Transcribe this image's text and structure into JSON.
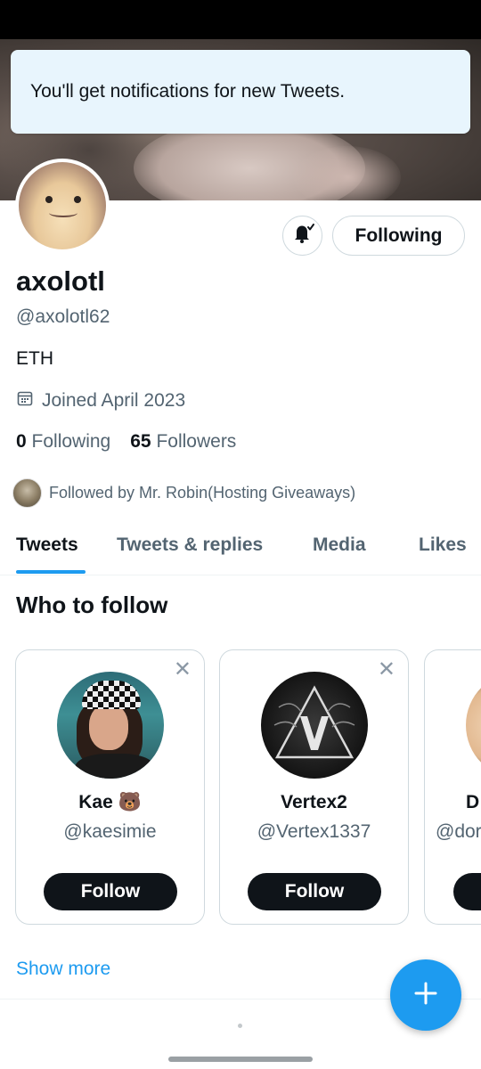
{
  "toast": {
    "message": "You'll get notifications for new Tweets."
  },
  "profile": {
    "display_name": "axolotl",
    "handle": "@axolotl62",
    "bio": "ETH",
    "joined": "Joined April 2023",
    "following_count": "0",
    "following_label": "Following",
    "followers_count": "65",
    "followers_label": "Followers",
    "followed_by": "Followed by Mr. Robin(Hosting Giveaways)",
    "follow_state_label": "Following",
    "bell_icon": "bell-subscribed-icon"
  },
  "tabs": [
    {
      "label": "Tweets",
      "active": true
    },
    {
      "label": "Tweets & replies",
      "active": false
    },
    {
      "label": "Media",
      "active": false
    },
    {
      "label": "Likes",
      "active": false
    }
  ],
  "who_to_follow": {
    "title": "Who to follow",
    "cards": [
      {
        "name": "Kae 🐻",
        "handle": "@kaesimie",
        "button": "Follow"
      },
      {
        "name": "Vertex2",
        "handle": "@Vertex1337",
        "button": "Follow"
      },
      {
        "name": "D",
        "handle": "@dor",
        "button": "Follow"
      }
    ],
    "show_more": "Show more"
  },
  "colors": {
    "accent": "#1d9bf0",
    "text_primary": "#0f1419",
    "text_secondary": "#536471",
    "toast_bg": "#e8f5fd"
  }
}
